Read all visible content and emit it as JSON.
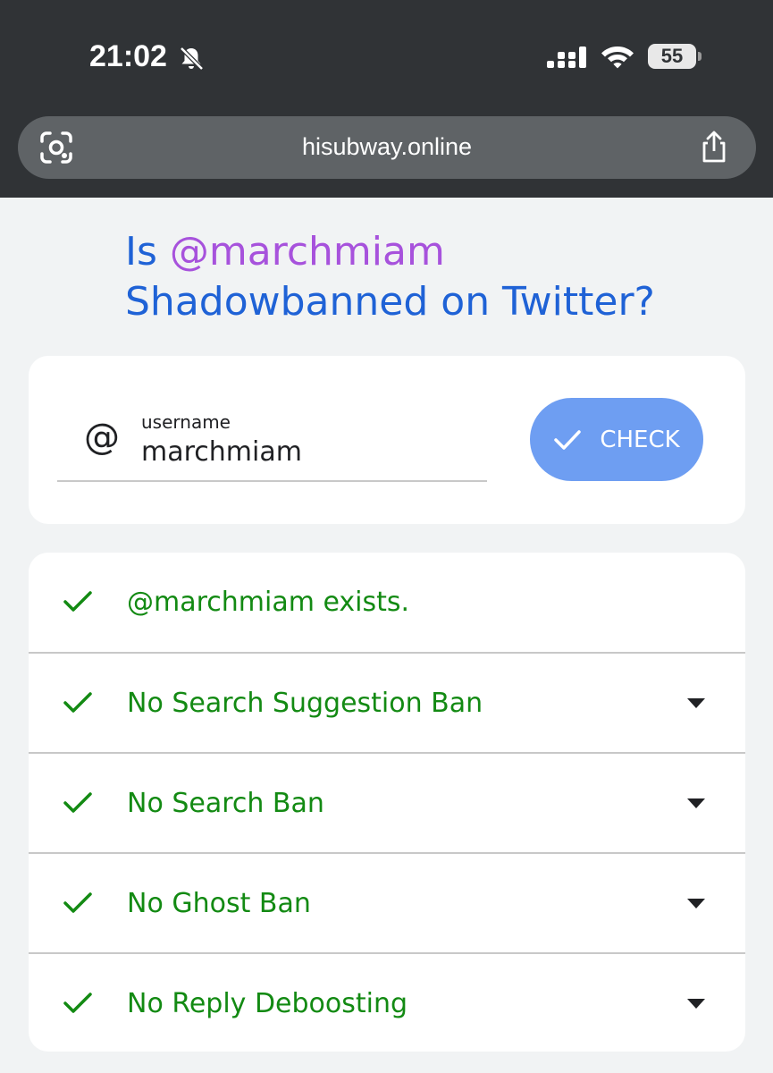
{
  "status_bar": {
    "time": "21:02",
    "battery": "55"
  },
  "browser": {
    "url": "hisubway.online"
  },
  "heading": {
    "prefix": "Is ",
    "handle": "@marchmiam",
    "line2": "Shadowbanned on Twitter?"
  },
  "form": {
    "at_symbol": "@",
    "label": "username",
    "value": "marchmiam",
    "button_label": "CHECK"
  },
  "results": [
    {
      "text": "@marchmiam exists.",
      "expandable": false
    },
    {
      "text": "No Search Suggestion Ban",
      "expandable": true
    },
    {
      "text": "No Search Ban",
      "expandable": true
    },
    {
      "text": "No Ghost Ban",
      "expandable": true
    },
    {
      "text": "No Reply Deboosting",
      "expandable": true
    }
  ],
  "colors": {
    "heading": "#1f62d6",
    "handle": "#a752dc",
    "success": "#138a13",
    "button": "#6e9ef2"
  },
  "icons": {
    "status": [
      "bell-off-icon",
      "signal-icon",
      "wifi-icon",
      "battery-icon"
    ],
    "browser": [
      "lens-icon",
      "share-icon"
    ],
    "result": [
      "checkmark-icon",
      "caret-down-icon"
    ]
  }
}
